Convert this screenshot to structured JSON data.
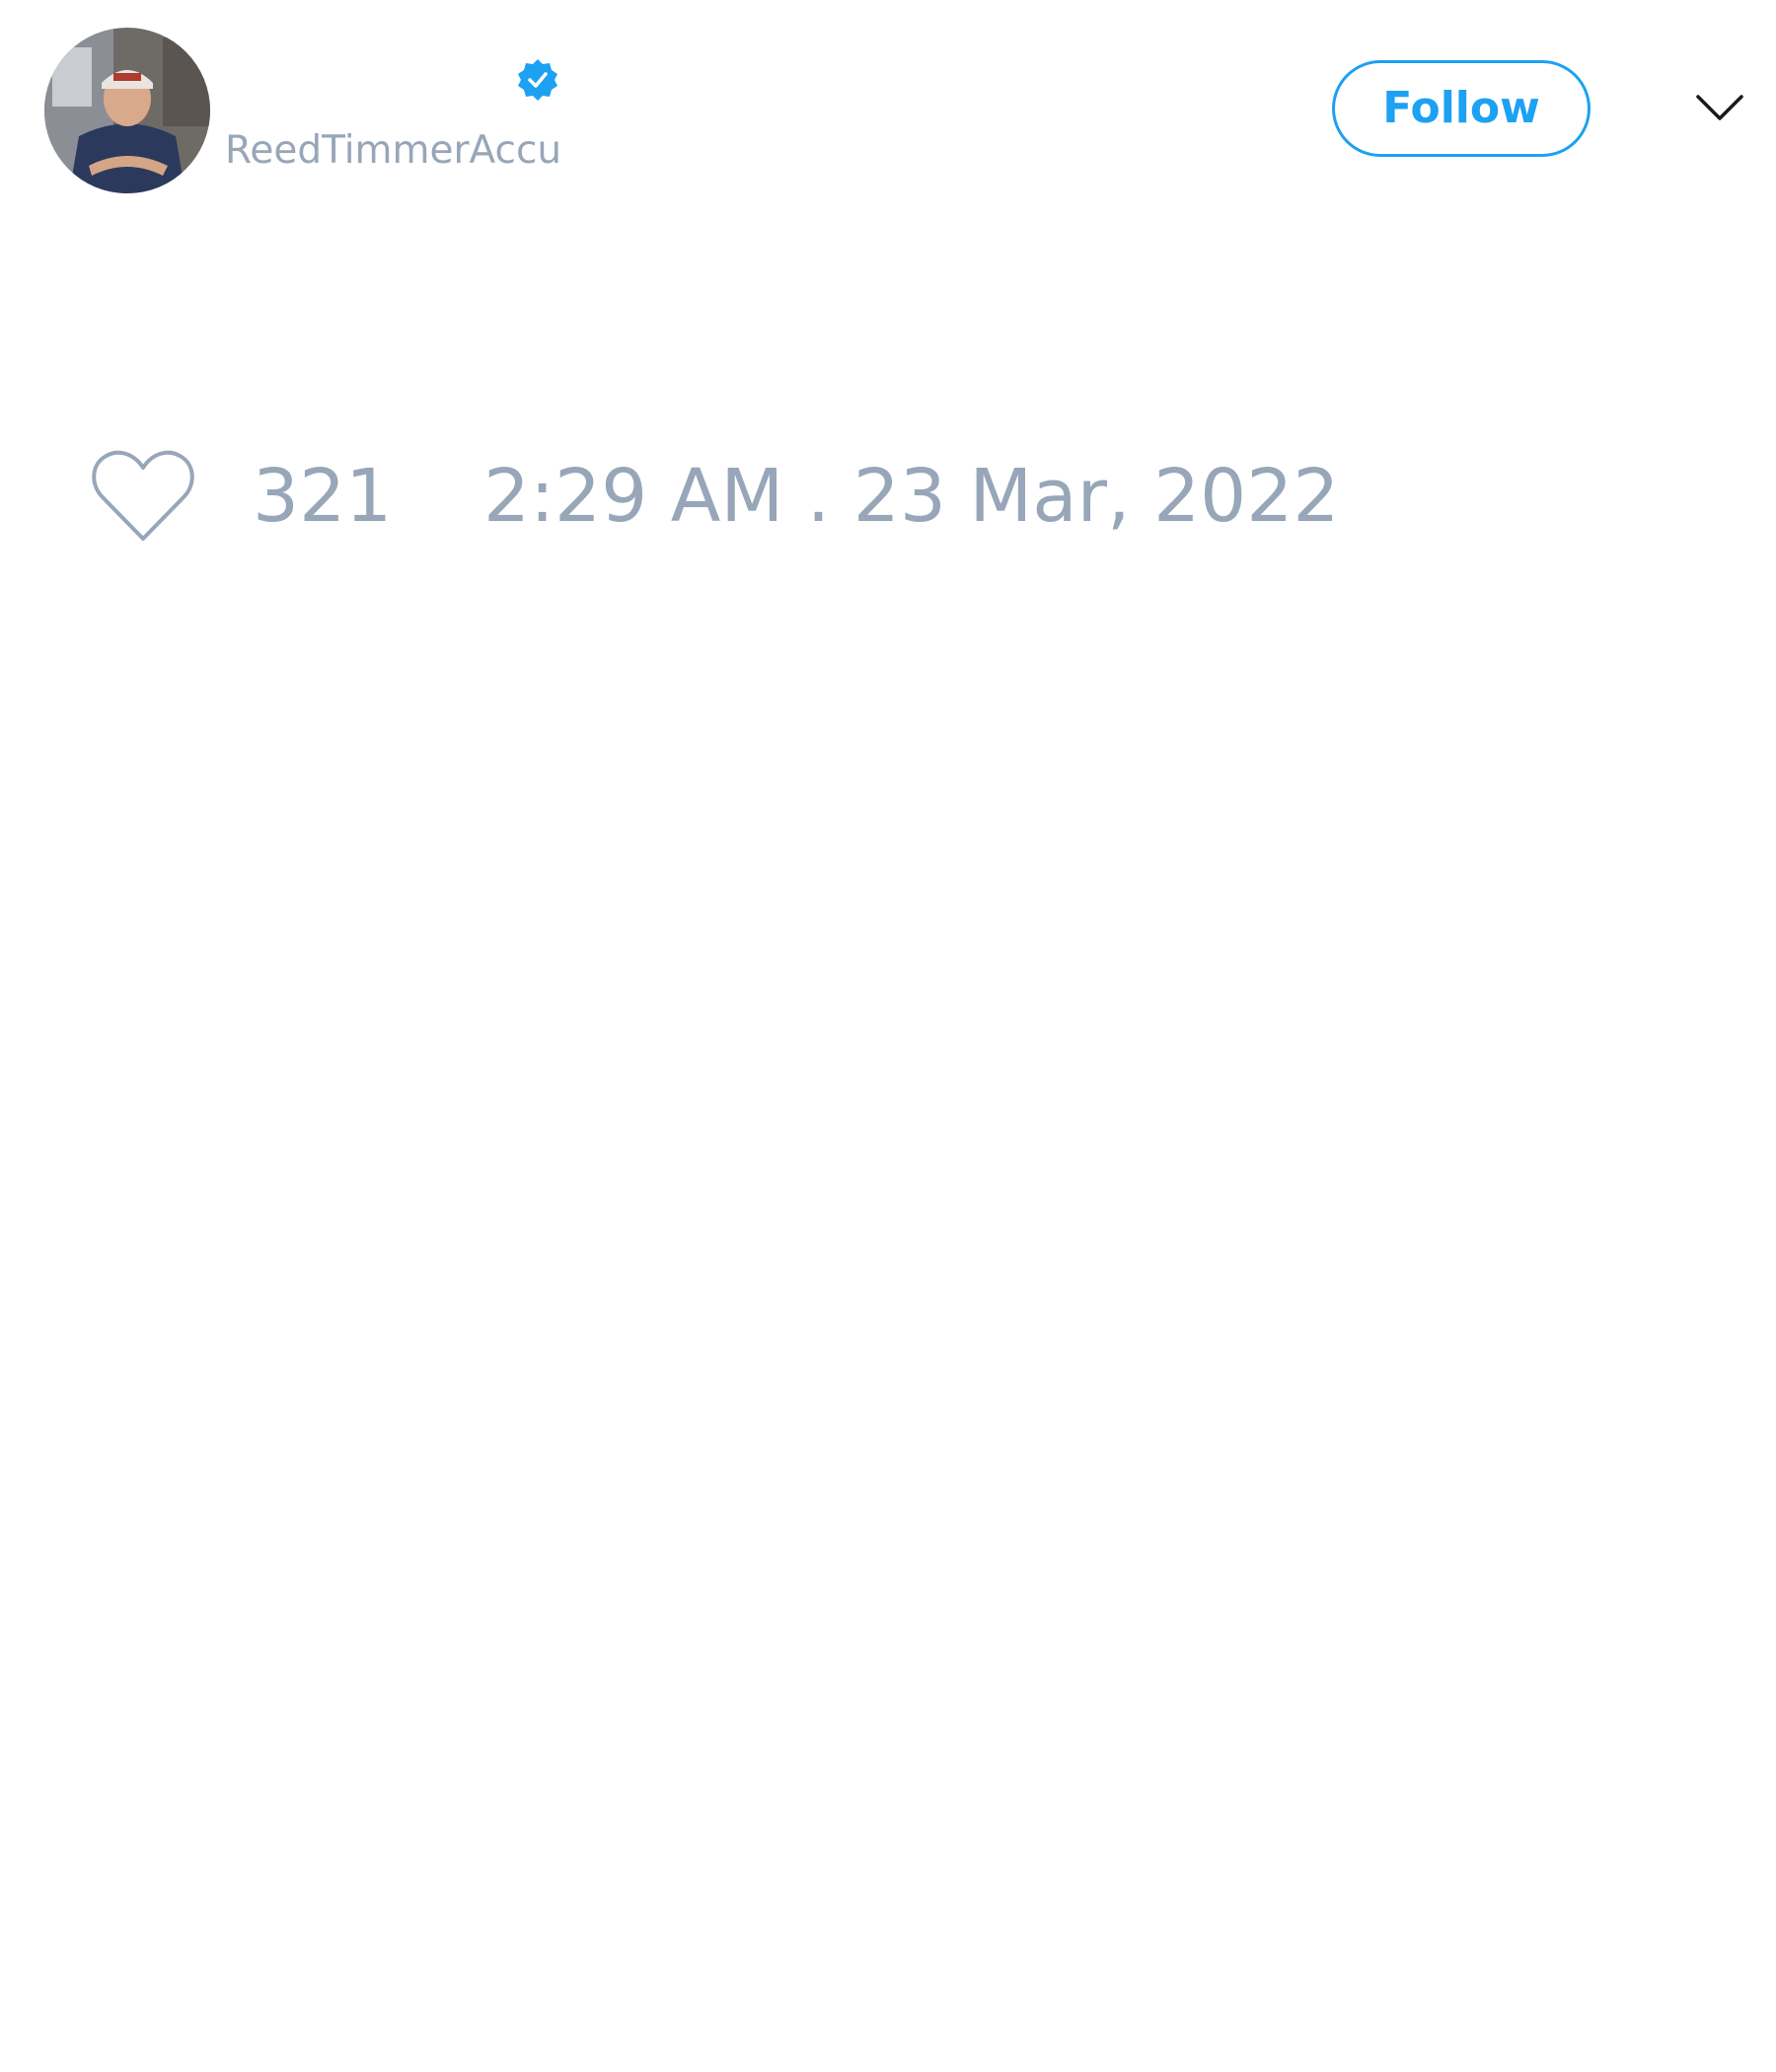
{
  "tweet": {
    "author": {
      "handle": "ReedTimmerAccu",
      "avatar_icon": "profile-photo",
      "verified_icon": "verified-badge-icon"
    },
    "follow_label": "Follow",
    "menu_icon": "chevron-down-icon",
    "like_icon": "heart-icon",
    "like_count": "321",
    "timestamp": "2:29 AM . 23 Mar, 2022"
  },
  "colors": {
    "accent": "#1da1f2",
    "muted_text": "#97a6b8",
    "background": "#ffffff"
  }
}
